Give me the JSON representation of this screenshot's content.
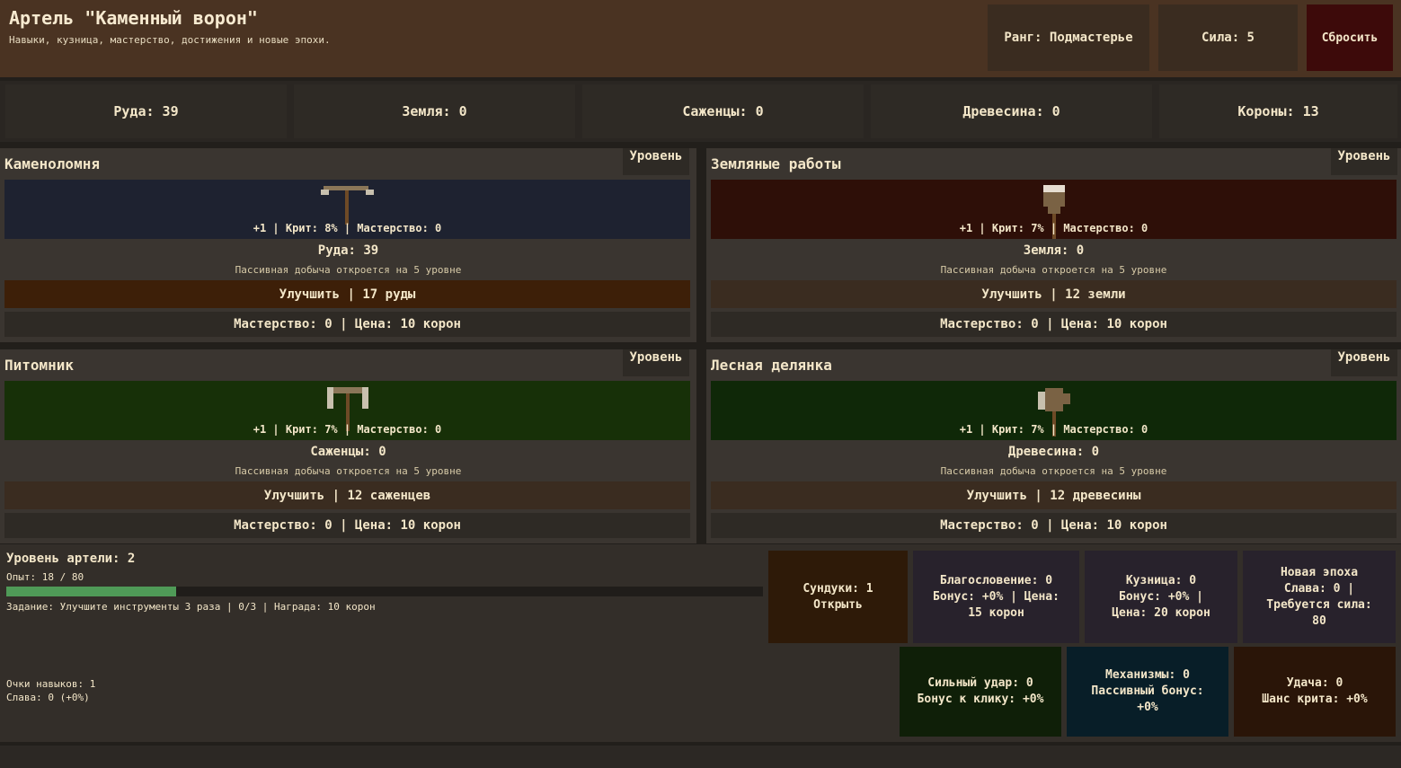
{
  "header": {
    "title": "Артель \"Каменный ворон\"",
    "subtitle": "Навыки, кузница, мастерство, достижения и новые эпохи.",
    "rank": "Ранг: Подмастерье",
    "power": "Сила: 5",
    "reset_label": "Сбросить"
  },
  "resources": [
    {
      "label": "Руда: 39"
    },
    {
      "label": "Земля: 0"
    },
    {
      "label": "Саженцы: 0"
    },
    {
      "label": "Древесина: 0"
    },
    {
      "label": "Короны: 13"
    }
  ],
  "panels": [
    {
      "title": "Каменоломня",
      "level_label": "Уровень",
      "stats": "+1 | Крит: 8% | Мастерство: 0",
      "amount": "Руда: 39",
      "passive": "Пассивная добыча откроется на 5 уровне",
      "upgrade": "Улучшить | 17 руды",
      "mastery": "Мастерство: 0 | Цена: 10 корон",
      "icon": "pickaxe-icon",
      "bg": "#1e2230",
      "upgrade_bg": "#3d1f08"
    },
    {
      "title": "Земляные работы",
      "level_label": "Уровень",
      "stats": "+1 | Крит: 7% | Мастерство: 0",
      "amount": "Земля: 0",
      "passive": "Пассивная добыча откроется на 5 уровне",
      "upgrade": "Улучшить | 12 земли",
      "mastery": "Мастерство: 0 | Цена: 10 корон",
      "icon": "shovel-icon",
      "bg": "#2e0f08",
      "upgrade_bg": "#3a2c20"
    },
    {
      "title": "Питомник",
      "level_label": "Уровень",
      "stats": "+1 | Крит: 7% | Мастерство: 0",
      "amount": "Саженцы: 0",
      "passive": "Пассивная добыча откроется на 5 уровне",
      "upgrade": "Улучшить | 12 саженцев",
      "mastery": "Мастерство: 0 | Цена: 10 корон",
      "icon": "hoe-icon",
      "bg": "#173008",
      "upgrade_bg": "#3a2c20"
    },
    {
      "title": "Лесная делянка",
      "level_label": "Уровень",
      "stats": "+1 | Крит: 7% | Мастерство: 0",
      "amount": "Древесина: 0",
      "passive": "Пассивная добыча откроется на 5 уровне",
      "upgrade": "Улучшить | 12 древесины",
      "mastery": "Мастерство: 0 | Цена: 10 корон",
      "icon": "axe-icon",
      "bg": "#0f2808",
      "upgrade_bg": "#3a2c20"
    }
  ],
  "guild": {
    "level": "Уровень артели: 2",
    "exp_label": "Опыт: 18 / 80",
    "exp_fraction": 0.225,
    "task": "Задание: Улучшите инструменты 3 раза | 0/3 | Награда: 10 корон",
    "skill_points": "Очки навыков: 1",
    "fame": "Слава: 0 (+0%)"
  },
  "actions": {
    "chests": {
      "line1": "Сундуки: 1",
      "line2": "Открыть",
      "bg": "#2e1a08"
    },
    "blessing": {
      "line1": "Благословение: 0",
      "line2": "Бонус: +0% | Цена:",
      "line3": "15 корон",
      "bg": "#28222c"
    },
    "forge": {
      "line1": "Кузница: 0",
      "line2": "Бонус: +0% |",
      "line3": "Цена: 20 корон",
      "bg": "#28222c"
    },
    "new_era": {
      "line1": "Новая эпоха",
      "line2": "Слава: 0 |",
      "line3": "Требуется сила:",
      "line4": "80",
      "bg": "#28222c"
    },
    "strong_hit": {
      "line1": "Сильный удар: 0",
      "line2": "Бонус к клику: +0%",
      "bg": "#0f1f08"
    },
    "mechanisms": {
      "line1": "Механизмы: 0",
      "line2": "Пассивный бонус:",
      "line3": "+0%",
      "bg": "#081e28"
    },
    "luck": {
      "line1": "Удача: 0",
      "line2": "Шанс крита: +0%",
      "bg": "#2a1508"
    }
  }
}
